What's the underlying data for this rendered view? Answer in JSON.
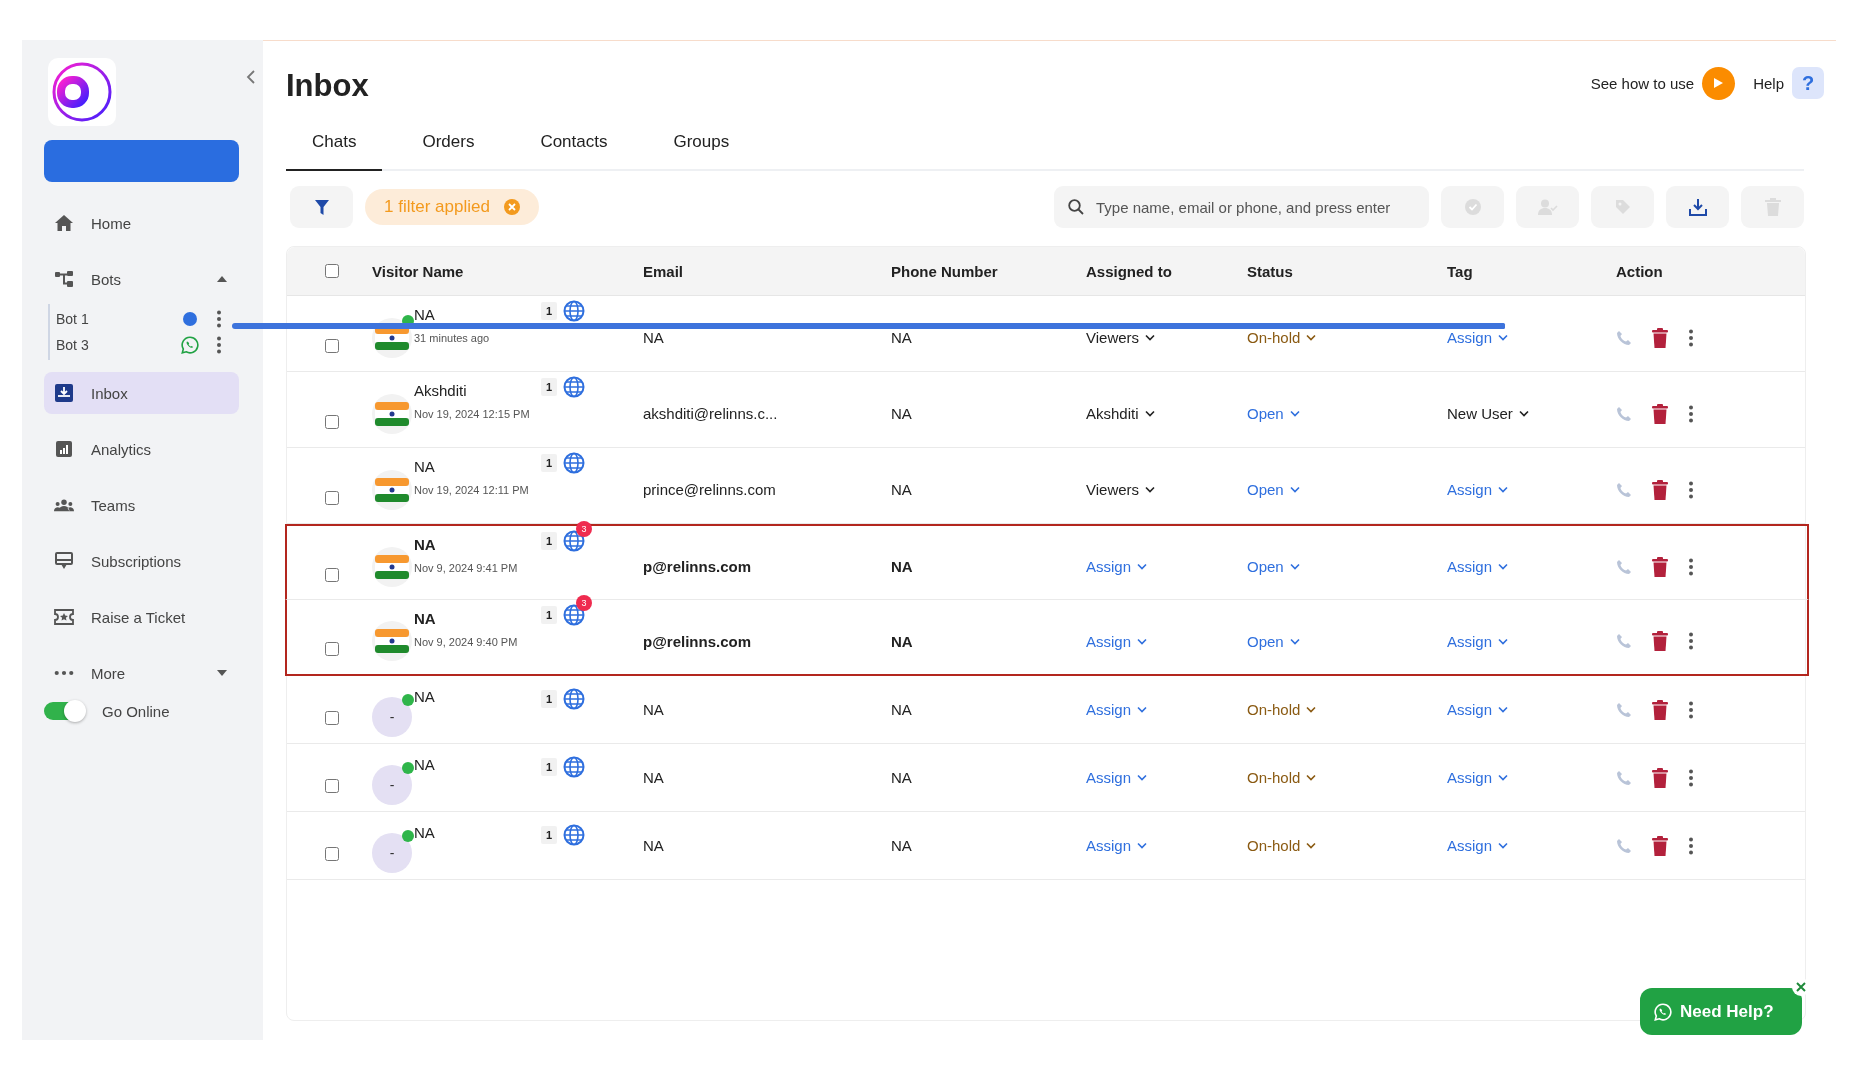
{
  "sidebar": {
    "items": [
      {
        "label": "Home",
        "selected": false
      },
      {
        "label": "Bots",
        "selected": false,
        "expanded": true,
        "children": [
          {
            "label": "Bot 1",
            "kind": "web"
          },
          {
            "label": "Bot 3",
            "kind": "whatsapp"
          }
        ]
      },
      {
        "label": "Inbox",
        "selected": true
      },
      {
        "label": "Analytics",
        "selected": false
      },
      {
        "label": "Teams",
        "selected": false
      },
      {
        "label": "Subscriptions",
        "selected": false
      },
      {
        "label": "Raise a Ticket",
        "selected": false
      },
      {
        "label": "More",
        "selected": false,
        "expanded": false
      }
    ],
    "online_toggle": {
      "label": "Go Online",
      "on": true
    }
  },
  "header": {
    "title": "Inbox",
    "guide_link": "See how to use",
    "help_link": "Help",
    "help_icon": "?"
  },
  "tabs": [
    {
      "label": "Chats",
      "selected": true
    },
    {
      "label": "Orders",
      "selected": false
    },
    {
      "label": "Contacts",
      "selected": false
    },
    {
      "label": "Groups",
      "selected": false
    }
  ],
  "toolbar": {
    "filter_chip": "1 filter applied",
    "search": {
      "placeholder": "Type name, email or phone, and press enter"
    },
    "buttons": [
      {
        "disabled": true
      },
      {
        "disabled": true
      },
      {
        "disabled": true
      },
      {
        "disabled": false
      },
      {
        "disabled": true
      }
    ]
  },
  "table": {
    "columns": [
      "Visitor Name",
      "Email",
      "Phone Number",
      "Assigned to",
      "Status",
      "Tag",
      "Action"
    ],
    "select_all": {
      "checked": false
    },
    "rows": [
      {
        "checked": false,
        "kind": "flag",
        "online": true,
        "name": "NA",
        "time": "31 minutes ago",
        "count": "1",
        "email": "NA",
        "phone": "NA",
        "assigned": {
          "text": "Viewers",
          "unassigned": false
        },
        "status": {
          "text": "On-hold",
          "kind": "on_hold"
        },
        "tag": {
          "text": "Assign",
          "unassigned": true
        },
        "unread_style": false,
        "highlighted": false
      },
      {
        "checked": false,
        "kind": "flag",
        "online": false,
        "name": "Akshditi",
        "time": "Nov 19, 2024 12:15 PM",
        "count": "1",
        "email": "akshditi@relinns.c...",
        "phone": "NA",
        "assigned": {
          "text": "Akshditi",
          "unassigned": false
        },
        "status": {
          "text": "Open",
          "kind": "open"
        },
        "tag": {
          "text": "New User",
          "unassigned": false
        },
        "unread_style": false,
        "highlighted": false
      },
      {
        "checked": false,
        "kind": "flag",
        "online": false,
        "name": "NA",
        "time": "Nov 19, 2024 12:11 PM",
        "count": "1",
        "email": "prince@relinns.com",
        "phone": "NA",
        "assigned": {
          "text": "Viewers",
          "unassigned": false
        },
        "status": {
          "text": "Open",
          "kind": "open"
        },
        "tag": {
          "text": "Assign",
          "unassigned": true
        },
        "unread_style": false,
        "highlighted": false
      },
      {
        "checked": false,
        "kind": "flag",
        "online": false,
        "name": "NA",
        "time": "Nov 9, 2024 9:41 PM",
        "count": "1",
        "unread": "3",
        "email": "p@relinns.com",
        "phone": "NA",
        "assigned": {
          "text": "Assign",
          "unassigned": true
        },
        "status": {
          "text": "Open",
          "kind": "open"
        },
        "tag": {
          "text": "Assign",
          "unassigned": true
        },
        "unread_style": true,
        "highlighted": true
      },
      {
        "checked": false,
        "kind": "flag",
        "online": false,
        "name": "NA",
        "time": "Nov 9, 2024 9:40 PM",
        "count": "1",
        "unread": "3",
        "email": "p@relinns.com",
        "phone": "NA",
        "assigned": {
          "text": "Assign",
          "unassigned": true
        },
        "status": {
          "text": "Open",
          "kind": "open"
        },
        "tag": {
          "text": "Assign",
          "unassigned": true
        },
        "unread_style": true,
        "highlighted": true
      },
      {
        "checked": false,
        "kind": "blank",
        "avatar_text": "-",
        "online": true,
        "name": "NA",
        "count": "1",
        "email": "NA",
        "phone": "NA",
        "assigned": {
          "text": "Assign",
          "unassigned": true
        },
        "status": {
          "text": "On-hold",
          "kind": "on_hold"
        },
        "tag": {
          "text": "Assign",
          "unassigned": true
        },
        "unread_style": false,
        "highlighted": false
      },
      {
        "checked": false,
        "kind": "blank",
        "avatar_text": "-",
        "online": true,
        "name": "NA",
        "count": "1",
        "email": "NA",
        "phone": "NA",
        "assigned": {
          "text": "Assign",
          "unassigned": true
        },
        "status": {
          "text": "On-hold",
          "kind": "on_hold"
        },
        "tag": {
          "text": "Assign",
          "unassigned": true
        },
        "unread_style": false,
        "highlighted": false
      },
      {
        "checked": false,
        "kind": "blank",
        "avatar_text": "-",
        "online": true,
        "name": "NA",
        "count": "1",
        "email": "NA",
        "phone": "NA",
        "assigned": {
          "text": "Assign",
          "unassigned": true
        },
        "status": {
          "text": "On-hold",
          "kind": "on_hold"
        },
        "tag": {
          "text": "Assign",
          "unassigned": true
        },
        "unread_style": false,
        "highlighted": false
      }
    ]
  },
  "help_widget": {
    "label": "Need Help?"
  }
}
